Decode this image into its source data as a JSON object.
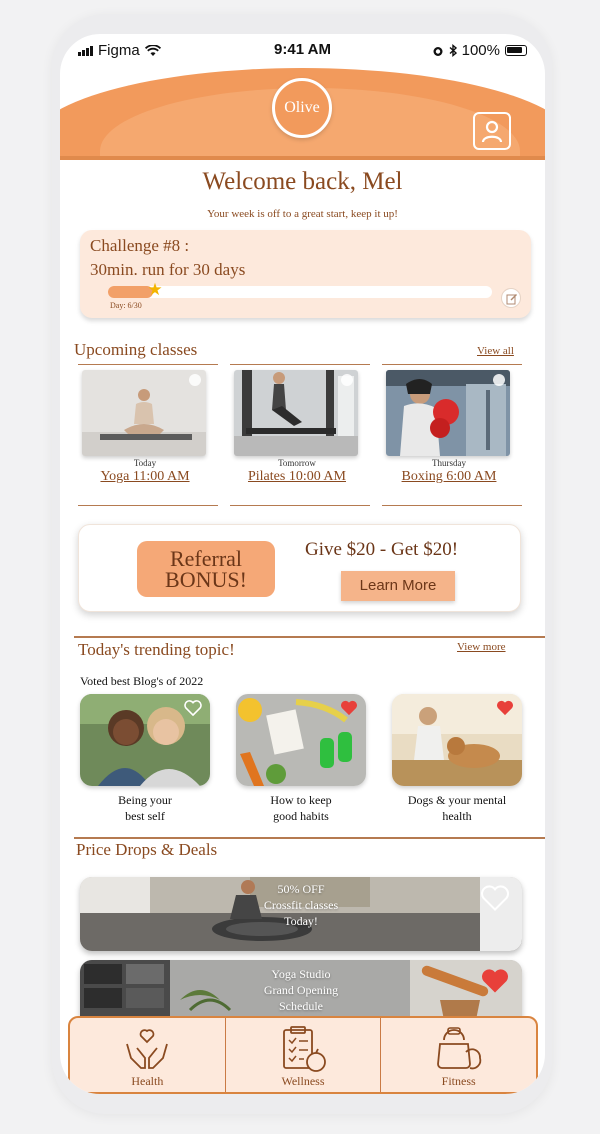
{
  "status_bar": {
    "carrier": "Figma",
    "time": "9:41 AM",
    "battery": "100%"
  },
  "header": {
    "logo": "Olive",
    "profile_icon": "profile-icon"
  },
  "welcome": {
    "title": "Welcome back, Mel",
    "subtitle": "Your week is off to a great start, keep it up!"
  },
  "challenge": {
    "title": "Challenge #8 :",
    "description": "30min. run for 30 days",
    "progress_label": "Day: 6/30",
    "progress_fraction": 0.2
  },
  "upcoming": {
    "title": "Upcoming classes",
    "view_all": "View all",
    "classes": [
      {
        "day": "Today",
        "name": "Yoga 11:00 AM"
      },
      {
        "day": "Tomorrow",
        "name": "Pilates 10:00 AM"
      },
      {
        "day": "Thursday",
        "name": "Boxing 6:00 AM"
      }
    ]
  },
  "referral": {
    "badge_line1": "Referral",
    "badge_line2": "BONUS!",
    "title": "Give $20 - Get $20!",
    "button": "Learn More"
  },
  "trending": {
    "title": "Today's trending topic!",
    "view_more": "View more",
    "subtitle": "Voted best Blog's of 2022",
    "blogs": [
      {
        "line1": "Being your",
        "line2": "best self",
        "liked": false
      },
      {
        "line1": "How to keep",
        "line2": "good habits",
        "liked": true
      },
      {
        "line1": "Dogs & your mental",
        "line2": "health",
        "liked": true
      }
    ]
  },
  "deals": {
    "title": "Price Drops & Deals",
    "items": [
      {
        "line1": "50% OFF",
        "line2": "Crossfit classes",
        "line3": "Today!",
        "liked": false
      },
      {
        "line1": "Yoga Studio",
        "line2": "Grand Opening",
        "line3": "Schedule",
        "liked": true
      }
    ]
  },
  "tabs": [
    {
      "label": "Health",
      "icon": "hands-heart-icon"
    },
    {
      "label": "Wellness",
      "icon": "clipboard-apple-icon"
    },
    {
      "label": "Fitness",
      "icon": "kettlebell-icon"
    }
  ],
  "colors": {
    "accent": "#f29a5c",
    "text_brown": "#8a4a20",
    "soft_peach": "#fde9dc",
    "heart_red": "#e8403a"
  }
}
